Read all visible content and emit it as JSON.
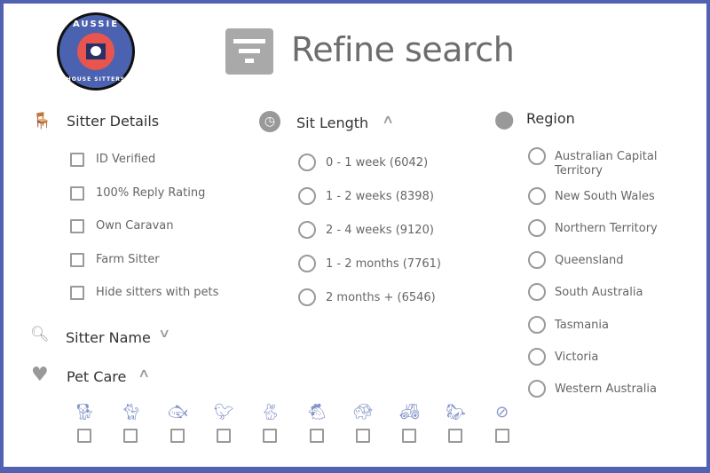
{
  "brand": {
    "logo_text_top": "AUSSIE",
    "logo_text_bottom": "HOUSE SITTERS",
    "border_color": "#5362b0",
    "accent_pet_icon": "#8696c8"
  },
  "header": {
    "title": "Refine search",
    "icon": "filter-icon"
  },
  "sitter_details": {
    "title": "Sitter Details",
    "icon": "chair-icon",
    "items": [
      {
        "label": "ID Verified",
        "checked": false
      },
      {
        "label": "100% Reply Rating",
        "checked": false
      },
      {
        "label": "Own Caravan",
        "checked": false
      },
      {
        "label": "Farm Sitter",
        "checked": false
      },
      {
        "label": "Hide sitters with pets",
        "checked": false
      }
    ]
  },
  "sitter_name": {
    "title": "Sitter Name",
    "icon": "search-icon",
    "expanded": false
  },
  "pet_care": {
    "title": "Pet Care",
    "icon": "heart-icon",
    "expanded": true,
    "pets": [
      "dog",
      "cat",
      "fish",
      "bird",
      "rabbit",
      "poultry",
      "reptile",
      "farm",
      "horse",
      "none"
    ]
  },
  "sit_length": {
    "title": "Sit Length",
    "icon": "clock-icon",
    "expanded": true,
    "options": [
      "0 - 1 week (6042)",
      "1 - 2 weeks (8398)",
      "2 - 4 weeks (9120)",
      "1 - 2 months (7761)",
      "2 months + (6546)"
    ]
  },
  "region": {
    "title": "Region",
    "icon": "location-pin-icon",
    "options": [
      "Australian Capital Territory",
      "New South Wales",
      "Northern Territory",
      "Queensland",
      "South Australia",
      "Tasmania",
      "Victoria",
      "Western Australia"
    ]
  }
}
